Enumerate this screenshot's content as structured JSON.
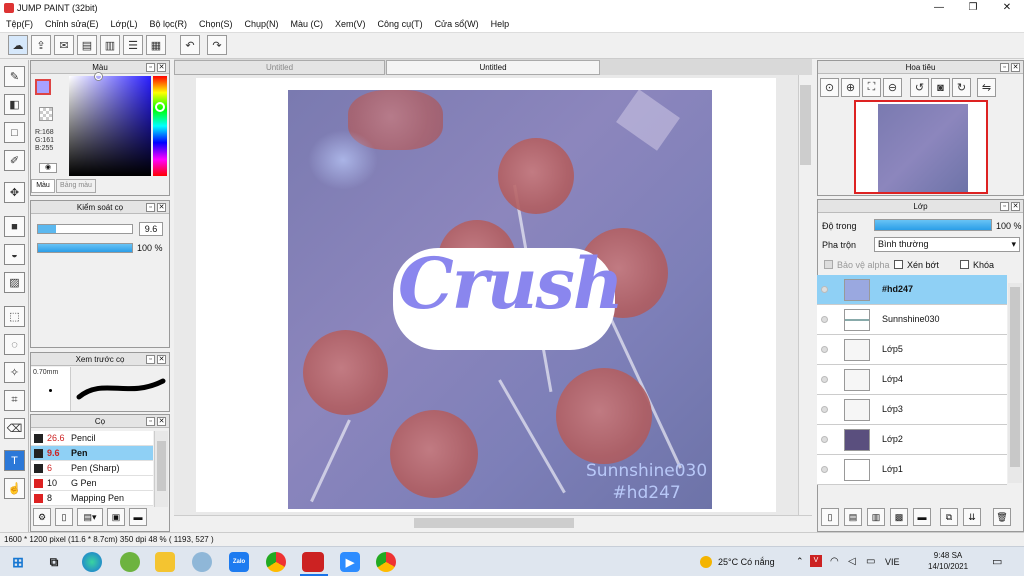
{
  "window": {
    "title": "JUMP PAINT (32bit)",
    "min": "—",
    "max": "❐",
    "close": "✕"
  },
  "menu": [
    "Tệp(F)",
    "Chỉnh sửa(E)",
    "Lớp(L)",
    "Bộ lọc(R)",
    "Chọn(S)",
    "Chụp(N)",
    "Màu (C)",
    "Xem(V)",
    "Công cụ(T)",
    "Cửa sổ(W)",
    "Help"
  ],
  "panels": {
    "color": {
      "title": "Màu",
      "r": "R:168",
      "g": "G:161",
      "b": "B:255",
      "tab1": "Màu",
      "tab2": "Bảng màu"
    },
    "brush_control": {
      "title": "Kiểm soát cọ",
      "size": "9.6",
      "opacity": "100 %"
    },
    "brush_preview": {
      "title": "Xem trước cọ",
      "size_label": "0.70mm"
    },
    "brushes": {
      "title": "Cọ",
      "items": [
        {
          "size": "26.6",
          "name": "Pencil"
        },
        {
          "size": "9.6",
          "name": "Pen"
        },
        {
          "size": "6",
          "name": "Pen (Sharp)"
        },
        {
          "size": "10",
          "name": "G Pen"
        },
        {
          "size": "8",
          "name": "Mapping Pen"
        }
      ]
    },
    "navigator": {
      "title": "Hoa tiêu"
    },
    "layers": {
      "title": "Lớp",
      "opacity_label": "Độ trong",
      "opacity_value": "100 %",
      "blend_label": "Pha trộn",
      "blend_value": "Bình thường",
      "alpha_label": "Bảo vệ alpha",
      "clip_label": "Xén bớt",
      "lock_label": "Khóa",
      "items": [
        {
          "name": "#hd247"
        },
        {
          "name": "Sunnshine030"
        },
        {
          "name": "Lớp5"
        },
        {
          "name": "Lớp4"
        },
        {
          "name": "Lớp3"
        },
        {
          "name": "Lớp2"
        },
        {
          "name": "Lớp1"
        }
      ]
    }
  },
  "tabs": [
    "Untitled",
    "Untitled"
  ],
  "artwork": {
    "title_text": "Crush",
    "signature_line1": "Sunnshine030",
    "signature_line2": "#hd247"
  },
  "status": {
    "text": "1600 * 1200 pixel   (11.6 * 8.7cm)   350 dpi   48 %   ( 1193, 527 )"
  },
  "taskbar": {
    "weather": "25°C  Có nắng",
    "lang": "VIE",
    "time": "9:48 SA",
    "date": "14/10/2021",
    "zalo": "Zalo"
  },
  "colors": {
    "accent": "#9b95f5",
    "selected_layer": "#8fd0f5"
  }
}
